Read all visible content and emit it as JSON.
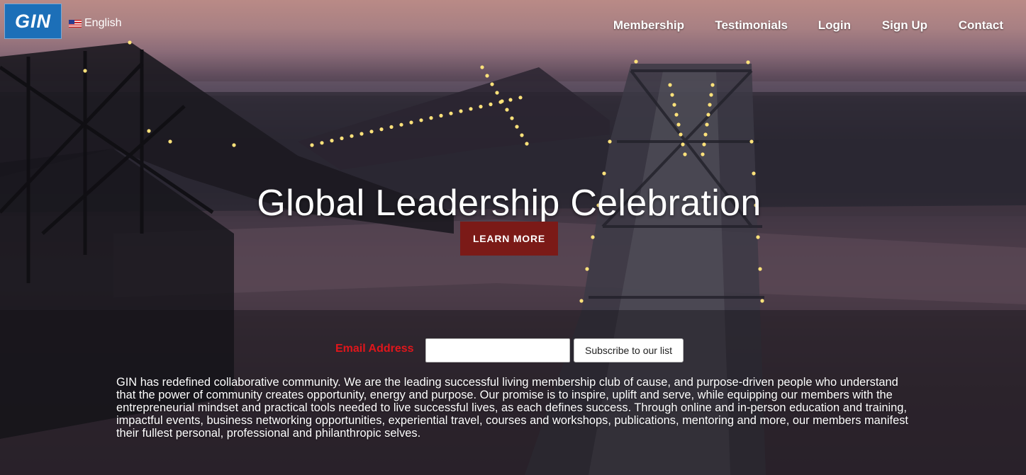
{
  "header": {
    "logo_text": "GIN",
    "language": "English",
    "nav": [
      {
        "label": "Membership"
      },
      {
        "label": "Testimonials"
      },
      {
        "label": "Login"
      },
      {
        "label": "Sign Up"
      },
      {
        "label": "Contact"
      }
    ]
  },
  "hero": {
    "title": "Global Leadership Celebration",
    "cta_label": "LEARN MORE",
    "background_image": "aerial view of illuminated bridges over a river at dusk"
  },
  "subscribe": {
    "label": "Email Address",
    "input_value": "",
    "button_label": "Subscribe to our list"
  },
  "about": {
    "text": "GIN has redefined collaborative community. We are the leading successful living membership club of cause, and purpose-driven people who understand that the power of community creates opportunity, energy and purpose. Our promise is to inspire, uplift and serve, while equipping our members with the entrepreneurial mindset and practical tools needed to live successful lives, as each defines success. Through online and in-person education and training, impactful events, business networking opportunities, experiential travel, courses and workshops, publications, mentoring and more, our members manifest their fullest personal, professional and philanthropic selves."
  },
  "colors": {
    "logo_bg": "#1c6fb8",
    "cta_bg": "#7b1a17",
    "email_label": "#e0161b",
    "nav_text": "#ffffff"
  },
  "icons": {
    "language_flag": "us-flag-icon"
  }
}
